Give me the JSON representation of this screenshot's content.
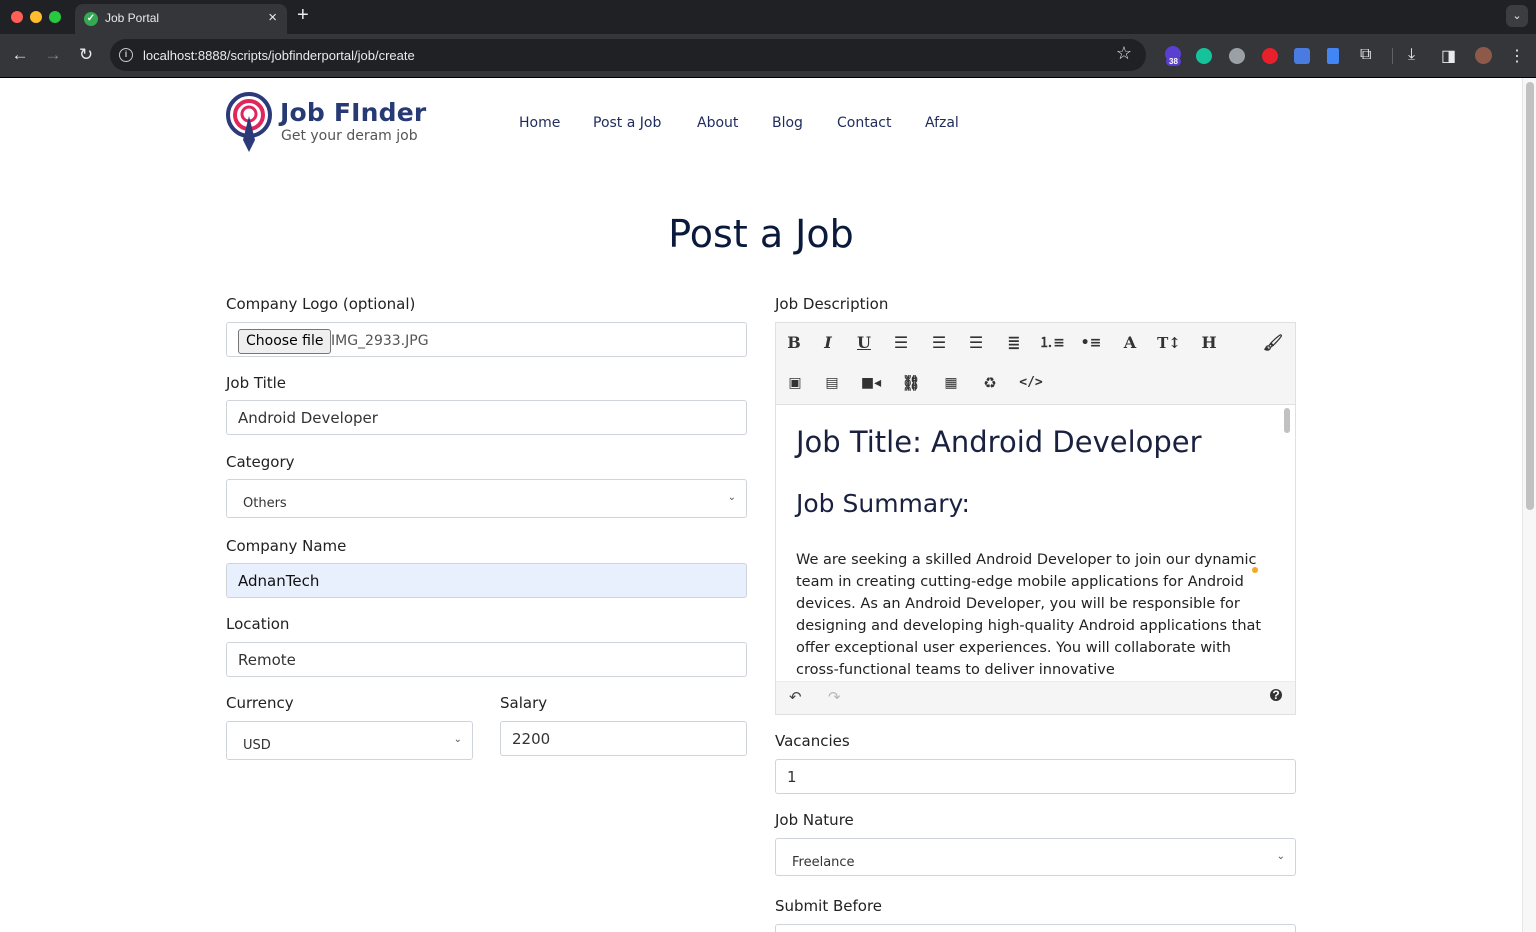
{
  "browser": {
    "tab_title": "Job Portal",
    "url": "localhost:8888/scripts/jobfinderportal/job/create",
    "extension_badge": "38"
  },
  "site": {
    "brand": "Job FInder",
    "tagline": "Get your deram job",
    "nav": [
      "Home",
      "Post a Job",
      "About",
      "Blog",
      "Contact",
      "Afzal"
    ]
  },
  "page": {
    "title": "Post a Job"
  },
  "form": {
    "logo_label": "Company Logo (optional)",
    "choose_file": "Choose file",
    "file_name": "IMG_2933.JPG",
    "job_title_label": "Job Title",
    "job_title_value": "Android Developer",
    "category_label": "Category",
    "category_value": "Others",
    "company_label": "Company Name",
    "company_value": "AdnanTech",
    "location_label": "Location",
    "location_value": "Remote",
    "currency_label": "Currency",
    "currency_value": "USD",
    "salary_label": "Salary",
    "salary_value": "2200",
    "description_label": "Job Description",
    "vacancies_label": "Vacancies",
    "vacancies_value": "1",
    "nature_label": "Job Nature",
    "nature_value": "Freelance",
    "submit_before_label": "Submit Before"
  },
  "editor": {
    "toolbar": [
      "bold-icon",
      "italic-icon",
      "underline-icon",
      "align-left-icon",
      "align-center-icon",
      "align-right-icon",
      "align-justify-icon",
      "ordered-list-icon",
      "unordered-list-icon",
      "font-icon",
      "font-size-icon",
      "heading-icon",
      "paint-brush-icon",
      "image-icon",
      "file-icon",
      "video-icon",
      "link-icon",
      "table-icon",
      "recycle-icon",
      "code-view-icon"
    ],
    "heading": "Job Title: Android Developer",
    "subheading": "Job Summary:",
    "paragraph": "We are seeking a skilled Android Developer to join our dynamic team in creating cutting-edge mobile applications for Android devices. As an Android Developer, you will be responsible for designing and developing high-quality Android applications that offer exceptional user experiences. You will collaborate with cross-functional teams to deliver innovative"
  }
}
